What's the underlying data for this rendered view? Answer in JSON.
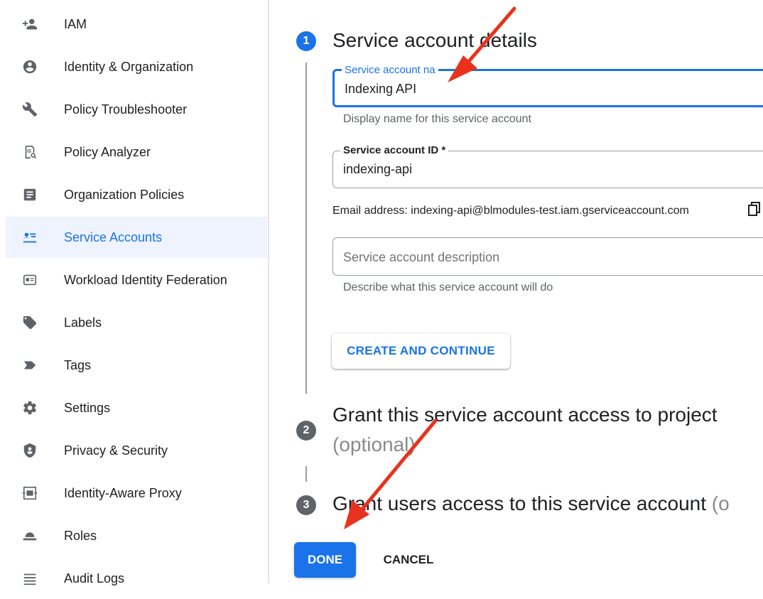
{
  "sidebar": {
    "items": [
      {
        "label": "IAM",
        "icon": "add-person-icon"
      },
      {
        "label": "Identity & Organization",
        "icon": "account-circle-icon"
      },
      {
        "label": "Policy Troubleshooter",
        "icon": "wrench-icon"
      },
      {
        "label": "Policy Analyzer",
        "icon": "document-search-icon"
      },
      {
        "label": "Organization Policies",
        "icon": "policy-document-icon"
      },
      {
        "label": "Service Accounts",
        "icon": "service-account-icon",
        "active": true
      },
      {
        "label": "Workload Identity Federation",
        "icon": "id-card-icon"
      },
      {
        "label": "Labels",
        "icon": "label-icon"
      },
      {
        "label": "Tags",
        "icon": "tag-icon"
      },
      {
        "label": "Settings",
        "icon": "gear-icon"
      },
      {
        "label": "Privacy & Security",
        "icon": "shield-icon"
      },
      {
        "label": "Identity-Aware Proxy",
        "icon": "proxy-icon"
      },
      {
        "label": "Roles",
        "icon": "roles-hat-icon"
      },
      {
        "label": "Audit Logs",
        "icon": "list-icon"
      }
    ]
  },
  "steps": [
    {
      "number": "1",
      "title": "Service account details"
    },
    {
      "number": "2",
      "title": "Grant this service account access to project",
      "suffix": "(optional)"
    },
    {
      "number": "3",
      "title": "Grant users access to this service account",
      "suffix": "(o"
    }
  ],
  "form": {
    "name_label": "Service account na",
    "name_value": "Indexing API",
    "name_helper": "Display name for this service account",
    "id_label": "Service account ID *",
    "id_value": "indexing-api",
    "email_text": "Email address: indexing-api@blmodules-test.iam.gserviceaccount.com",
    "description_placeholder": "Service account description",
    "description_helper": "Describe what this service account will do"
  },
  "buttons": {
    "create_continue": "CREATE AND CONTINUE",
    "done": "DONE",
    "cancel": "CANCEL"
  },
  "colors": {
    "accent": "#1a73e8",
    "active_bg": "#eef3fd",
    "annotation_arrow": "#e8321e",
    "step_inactive": "#5f6368"
  }
}
